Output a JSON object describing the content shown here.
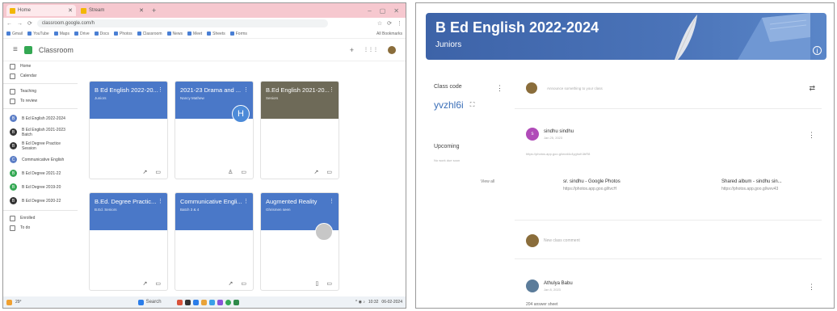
{
  "left": {
    "tabs": [
      {
        "label": "Home"
      },
      {
        "label": "Stream"
      }
    ],
    "tab_plus": "+",
    "window_controls": [
      "–",
      "▢",
      "✕"
    ],
    "address_url": "classroom.google.com/h",
    "toolbar_icons": [
      "☆",
      "⟳",
      "⋮"
    ],
    "bookmarks": [
      "Gmail",
      "YouTube",
      "Maps",
      "Drive",
      "Docs",
      "Photos",
      "Classroom",
      "News",
      "Meet",
      "Sheets",
      "Forms"
    ],
    "all_bookmarks_label": "All Bookmarks",
    "app": {
      "name": "Classroom",
      "plus": "+",
      "grid": "⋮⋮⋮"
    },
    "sidebar": {
      "nav": [
        {
          "label": "Home"
        },
        {
          "label": "Calendar"
        },
        {
          "label": "Teaching"
        },
        {
          "label": "To review"
        }
      ],
      "classes": [
        {
          "label": "B Ed English 2022-2024",
          "color": "#5c7ec6",
          "letter": "B"
        },
        {
          "label": "B Ed English 2021-2023 Batch",
          "color": "#333333",
          "letter": "B"
        },
        {
          "label": "B Ed Degree Practice Session",
          "color": "#333333",
          "letter": "B"
        },
        {
          "label": "Communicative English",
          "color": "#5c7ec6",
          "letter": "C"
        },
        {
          "label": "B Ed Degree 2021-22",
          "color": "#34a853",
          "letter": "B"
        },
        {
          "label": "B Ed Degree 2019-20",
          "color": "#34a853",
          "letter": "B"
        },
        {
          "label": "B Ed Degree 2020-22",
          "color": "#333333",
          "letter": "B"
        }
      ],
      "footer": [
        {
          "label": "Enrolled"
        },
        {
          "label": "To do"
        }
      ]
    },
    "cards": [
      {
        "title": "B Ed English 2022-20...",
        "subtitle": "Juniors",
        "color": "#4a78c8"
      },
      {
        "title": "2021-23 Drama and ...",
        "subtitle": "Nancy Mathew",
        "color": "#4a78c8"
      },
      {
        "title": "B.Ed English 2021-20...",
        "subtitle": "Seniors",
        "color": "#6e6a58"
      },
      {
        "title": "B.Ed. Degree Practic...",
        "subtitle": "B.Ed. Seniors",
        "color": "#4a78c8"
      },
      {
        "title": "Communicative Engli...",
        "subtitle": "Batch 3 & 4",
        "color": "#4a78c8"
      },
      {
        "title": "Augmented Reality",
        "subtitle": "Ghrismen seen",
        "color": "#4a78c8"
      }
    ],
    "h_badge": "H",
    "taskbar": {
      "weather": "29°",
      "search": "Search",
      "time": "10:32",
      "date": "06-02-2024"
    }
  },
  "right": {
    "title": "B Ed English 2022-2024",
    "subtitle": "Juniors",
    "info": "i",
    "class_code_label": "Class code",
    "class_code": "yvzhl6i",
    "upcoming_label": "Upcoming",
    "upcoming_sub": "No work due soon",
    "view_all": "View all",
    "announce_placeholder": "Announce something to your class",
    "posts": [
      {
        "name": "sindhu sindhu",
        "time": "Jan 25, 2023",
        "link": "https://photos.app.goo.gl/wvd4c4yghoK4bR8",
        "attachments": [
          {
            "title": "sr. sindhu - Google Photos",
            "url": "https://photos.app.goo.gl/tvcH"
          },
          {
            "title": "Shared album - sindhu sin...",
            "url": "https://photos.app.goo.gl/wvv43"
          }
        ]
      },
      {
        "name": "",
        "time": "",
        "text": "New class comment"
      },
      {
        "name": "Athulya Babu",
        "time": "Jan 8, 2023",
        "text": "204 answer sheet"
      }
    ]
  }
}
